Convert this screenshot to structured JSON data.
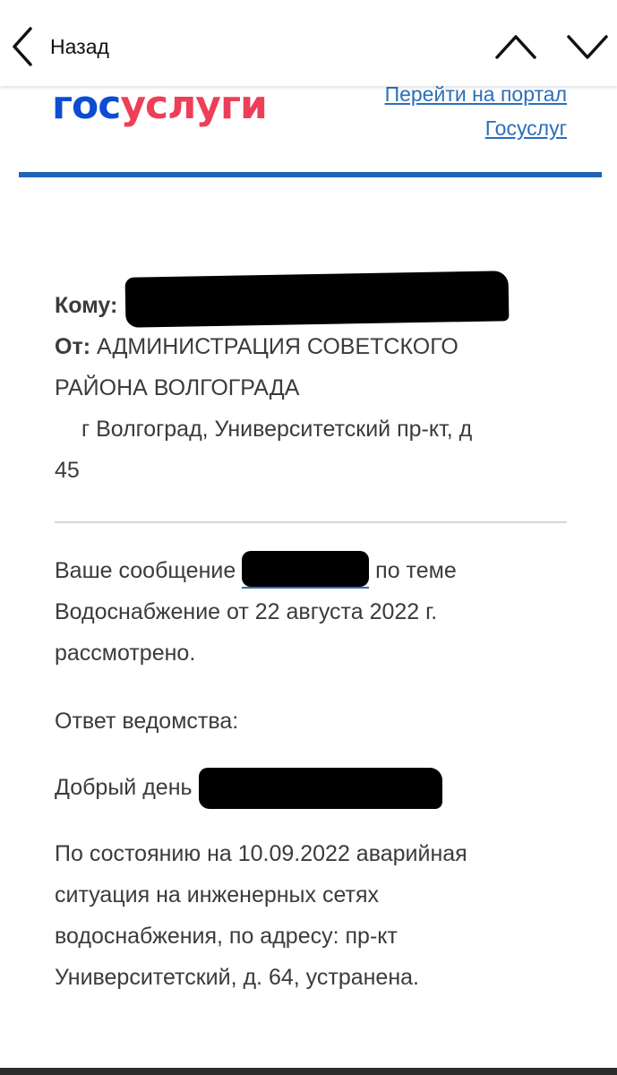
{
  "nav": {
    "back_label": "Назад",
    "back_icon": "chevron-left-icon",
    "prev_icon": "chevron-up-icon",
    "next_icon": "chevron-down-icon"
  },
  "header": {
    "logo_part1": "гос",
    "logo_part2": "услуги",
    "portal_link_line1": "Перейти на портал",
    "portal_link_line2": "Госуслуг"
  },
  "meta": {
    "to_label": "Кому:",
    "from_label": "От:",
    "from_value_line1": "АДМИНИСТРАЦИЯ СОВЕТСКОГО",
    "from_value_line2": "РАЙОНА ВОЛГОГРАДА",
    "address_line1": "г Волгоград, Университетский пр-кт, д",
    "address_line2": "45"
  },
  "message": {
    "prefix": "Ваше сообщение",
    "suffix_line1": "по теме",
    "line2": "Водоснабжение от 22 августа 2022 г.",
    "line3": "рассмотрено."
  },
  "answer": {
    "label": "Ответ ведомства:",
    "greeting": "Добрый день",
    "line1": "По состоянию на 10.09.2022 аварийная",
    "line2": "ситуация на инженерных сетях",
    "line3": "водоснабжения, по адресу: пр-кт",
    "line4": "Университетский, д. 64, устранена."
  },
  "colors": {
    "brand_blue": "#0d4cd3",
    "brand_red": "#ee3f58",
    "link_blue": "#2a6fba",
    "rule_blue": "#1f66b5",
    "text": "#3b3b3b"
  }
}
